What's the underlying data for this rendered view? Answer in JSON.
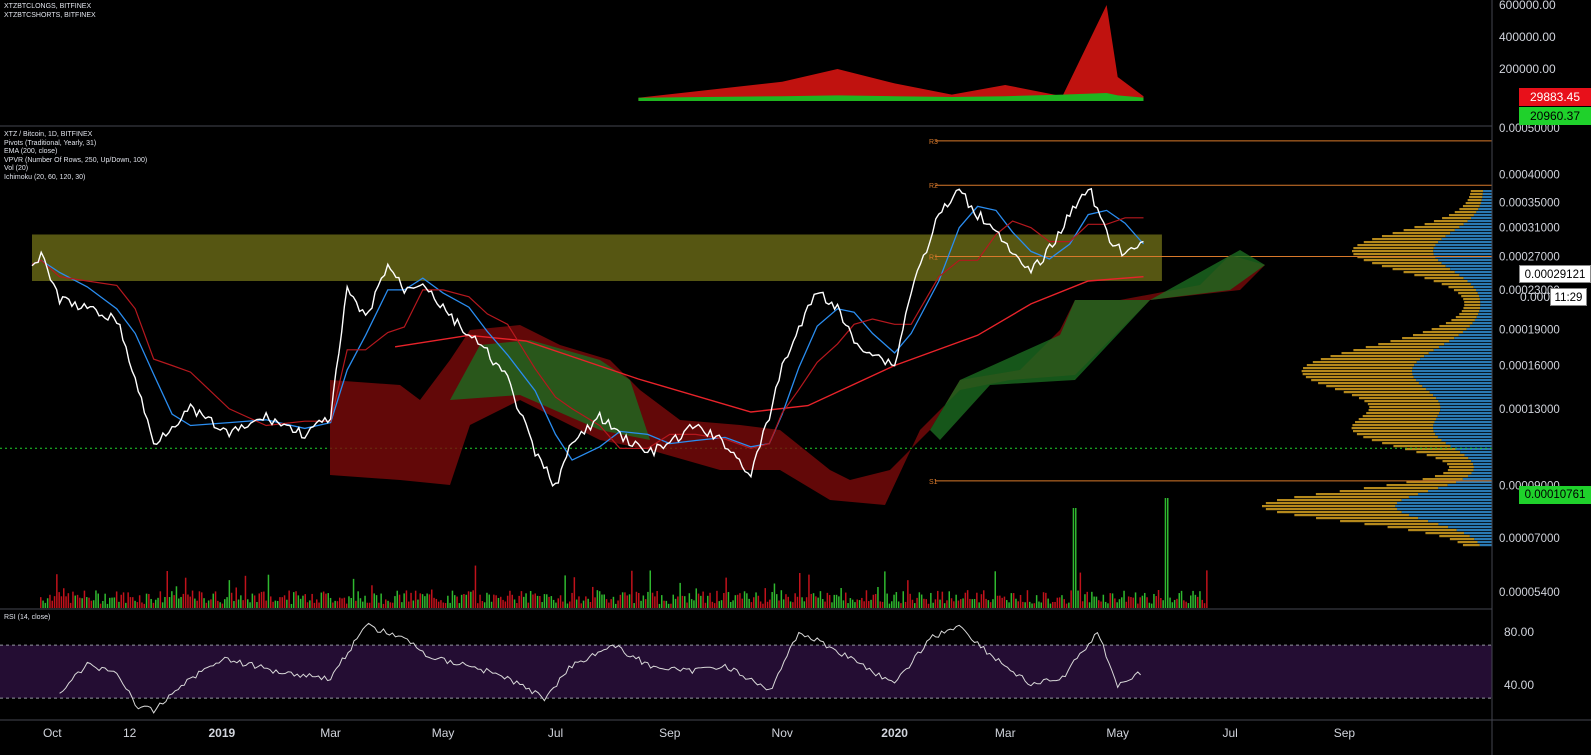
{
  "colors": {
    "background": "#000000",
    "price": "#ffffff",
    "ema": "#e8232a",
    "tenkan": "#2a8df0",
    "kijun": "#b5181e",
    "chikou": "#1e6b1e",
    "kumo_bull": "#1b6b20",
    "kumo_bear": "#7a0a0a",
    "vpvr_up": "#c9981f",
    "vpvr_down": "#2f86c6",
    "zone": "#7a7a1a",
    "pivot": "#d8792b",
    "rsi_band": "#2a0f3c",
    "longs": "#1fb41f",
    "shorts": "#c0120f"
  },
  "legend_top": [
    "XTZBTCLONGS, BITFINEX",
    "XTZBTCSHORTS, BITFINEX"
  ],
  "legend_main": [
    "XTZ / Bitcoin, 1D, BITFINEX",
    "Pivots (Traditional, Yearly, 31)",
    "EMA (200, close)",
    "VPVR (Number Of Rows, 250, Up/Down, 100)",
    "Vol (20)",
    "Ichimoku (20, 60, 120, 30)"
  ],
  "legend_rsi": "RSI (14, close)",
  "top_axis_labels": [
    "600000.00",
    "400000.00",
    "200000.00"
  ],
  "top_tags": {
    "shorts": "29883.45",
    "longs": "20960.37"
  },
  "price_axis_labels": [
    "0.00050000",
    "0.00040000",
    "0.00035000",
    "0.00031000",
    "0.00027000",
    "0.00023000",
    "0.00019000",
    "0.00016000",
    "0.00013000",
    "0.00009000",
    "0.00007000",
    "0.00005400"
  ],
  "price_tags": {
    "last": "0.00029121",
    "countdown": "11:29",
    "countdown_prefix": "0.000",
    "level": "0.00010761"
  },
  "rsi_axis_labels": [
    "80.00",
    "40.00"
  ],
  "pivot_labels": [
    "R3",
    "R2",
    "R1",
    "S1"
  ],
  "time_axis_labels": [
    "Oct",
    "12",
    "2019",
    "Mar",
    "May",
    "Jul",
    "Sep",
    "Nov",
    "2020",
    "Mar",
    "May",
    "Jul",
    "Sep"
  ],
  "chart_data": {
    "type": "line",
    "symbol": "XTZ / Bitcoin, 1D, BITFINEX",
    "x_range": [
      "2018-09-20",
      "2020-10-31"
    ],
    "y_log": true,
    "ylim": [
      5e-05,
      0.0005
    ],
    "price_series": {
      "dates": [
        "2018-09-20",
        "2018-09-25",
        "2018-10-05",
        "2018-10-20",
        "2018-11-05",
        "2018-11-15",
        "2018-11-25",
        "2018-12-05",
        "2018-12-15",
        "2019-01-05",
        "2019-01-25",
        "2019-02-15",
        "2019-03-01",
        "2019-03-10",
        "2019-03-20",
        "2019-04-01",
        "2019-04-10",
        "2019-04-20",
        "2019-05-01",
        "2019-05-15",
        "2019-05-25",
        "2019-06-05",
        "2019-06-20",
        "2019-07-01",
        "2019-07-10",
        "2019-07-25",
        "2019-08-05",
        "2019-08-20",
        "2019-09-01",
        "2019-09-15",
        "2019-10-01",
        "2019-10-15",
        "2019-10-25",
        "2019-11-01",
        "2019-11-10",
        "2019-11-20",
        "2019-12-01",
        "2019-12-10",
        "2019-12-20",
        "2020-01-01",
        "2020-01-10",
        "2020-01-25",
        "2020-02-05",
        "2020-02-15",
        "2020-02-25",
        "2020-03-05",
        "2020-03-15",
        "2020-03-25",
        "2020-04-05",
        "2020-04-15",
        "2020-04-25",
        "2020-05-05",
        "2020-05-15"
      ],
      "values": [
        0.00026,
        0.00027,
        0.00022,
        0.00021,
        0.0002,
        0.00015,
        0.00011,
        0.00012,
        0.00013,
        0.000115,
        0.000125,
        0.000115,
        0.000125,
        0.00023,
        0.0002,
        0.00026,
        0.00023,
        0.00024,
        0.00021,
        0.000185,
        0.00017,
        0.00015,
        0.000105,
        9e-05,
        0.00011,
        0.000125,
        0.000115,
        0.000105,
        0.00011,
        0.00012,
        0.00011,
        9.5e-05,
        0.000125,
        0.00016,
        0.00019,
        0.00023,
        0.00021,
        0.00018,
        0.00017,
        0.00016,
        0.00023,
        0.00033,
        0.00037,
        0.00033,
        0.00031,
        0.00027,
        0.00025,
        0.00028,
        0.00033,
        0.00038,
        0.0003,
        0.00027,
        0.00029
      ]
    },
    "ema_200": {
      "dates": [
        "2019-04-05",
        "2019-05-15",
        "2019-06-15",
        "2019-08-15",
        "2019-10-15",
        "2019-11-15",
        "2020-01-01",
        "2020-02-15",
        "2020-03-15",
        "2020-04-15",
        "2020-05-15"
      ],
      "values": [
        0.000175,
        0.000185,
        0.00018,
        0.00015,
        0.000128,
        0.000132,
        0.00016,
        0.000185,
        0.000215,
        0.00024,
        0.000245
      ]
    },
    "pivots": {
      "R3": 0.00047,
      "R2": 0.00038,
      "R1": 0.00027,
      "S1": 9.2e-05
    },
    "horizontal_level": 0.00010761,
    "support_zone": {
      "start": "2018-09-20",
      "end": "2020-05-25",
      "low": 0.00024,
      "high": 0.0003
    },
    "longs_shorts": {
      "dates": [
        "2019-08-15",
        "2019-11-01",
        "2019-12-01",
        "2020-01-01",
        "2020-02-01",
        "2020-03-01",
        "2020-04-01",
        "2020-04-25",
        "2020-05-01",
        "2020-05-15"
      ],
      "longs": [
        20000,
        30000,
        35000,
        30000,
        25000,
        30000,
        40000,
        50000,
        35000,
        20960.37
      ],
      "shorts": [
        20000,
        120000,
        200000,
        110000,
        40000,
        100000,
        30000,
        600000,
        150000,
        29883.45
      ]
    },
    "rsi": {
      "dates": [
        "2018-10-05",
        "2018-10-20",
        "2018-11-05",
        "2018-11-15",
        "2018-11-25",
        "2018-12-10",
        "2019-01-01",
        "2019-02-01",
        "2019-03-01",
        "2019-03-20",
        "2019-04-10",
        "2019-04-25",
        "2019-05-15",
        "2019-06-05",
        "2019-06-25",
        "2019-07-10",
        "2019-08-01",
        "2019-08-20",
        "2019-09-10",
        "2019-10-01",
        "2019-10-25",
        "2019-11-10",
        "2019-11-25",
        "2019-12-15",
        "2020-01-01",
        "2020-01-20",
        "2020-02-05",
        "2020-02-20",
        "2020-03-15",
        "2020-04-01",
        "2020-04-20",
        "2020-05-01",
        "2020-05-15"
      ],
      "values": [
        35,
        55,
        50,
        25,
        20,
        40,
        60,
        50,
        45,
        85,
        75,
        60,
        55,
        45,
        30,
        55,
        70,
        55,
        50,
        55,
        35,
        80,
        70,
        55,
        40,
        75,
        85,
        65,
        40,
        45,
        80,
        40,
        50
      ],
      "ylim": [
        15,
        95
      ],
      "band": [
        30,
        70
      ]
    }
  }
}
